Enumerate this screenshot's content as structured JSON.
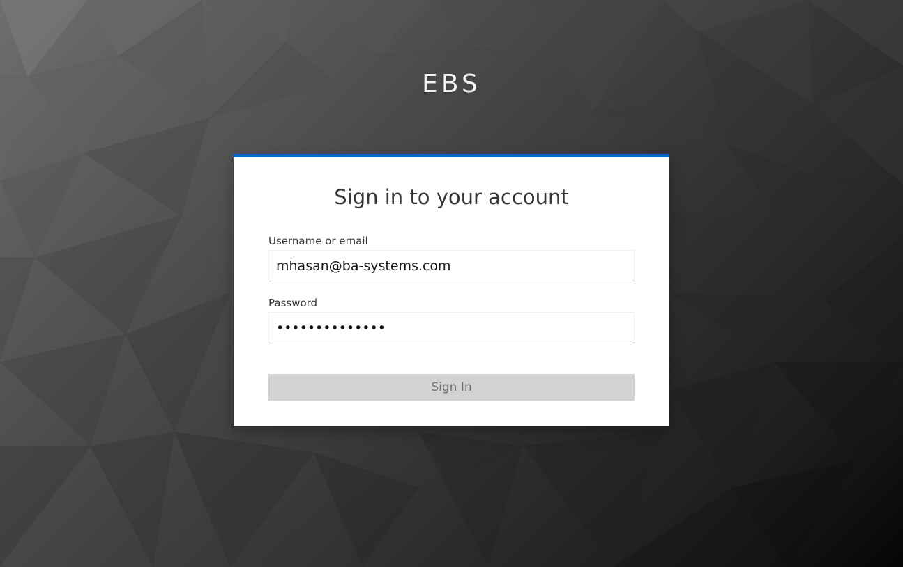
{
  "brand": {
    "title": "EBS"
  },
  "login": {
    "heading": "Sign in to your account",
    "username": {
      "label": "Username or email",
      "value": "mhasan@ba-systems.com"
    },
    "password": {
      "label": "Password",
      "value": "••••••••••••••"
    },
    "submit_label": "Sign In"
  },
  "colors": {
    "accent": "#0066cc",
    "button_disabled_bg": "#d2d2d2",
    "button_disabled_text": "#6a6e73"
  }
}
